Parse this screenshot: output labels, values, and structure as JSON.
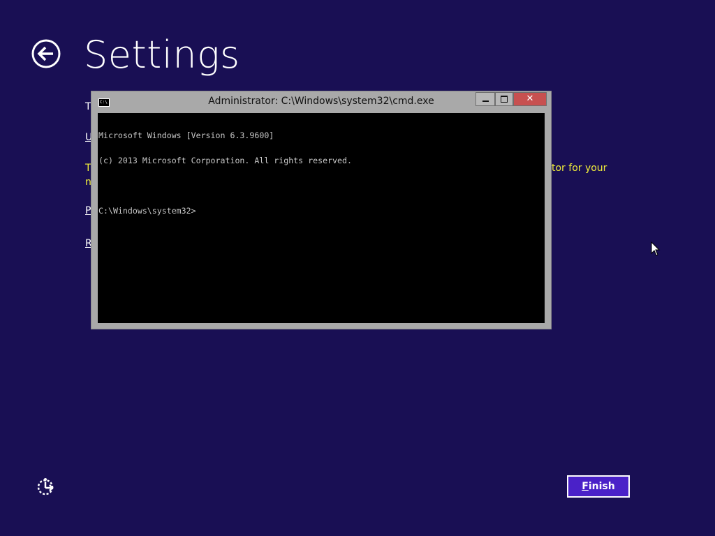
{
  "page": {
    "title": "Settings",
    "background_color": "#190f54",
    "accent_color": "#4a21c8"
  },
  "background_text": {
    "line1": "T",
    "line2": "U",
    "line3a": "T",
    "line3b": "n",
    "line3_right": "tor for your",
    "line4": "P",
    "line5": "R"
  },
  "cmd_window": {
    "title": "Administrator: C:\\Windows\\system32\\cmd.exe",
    "app_icon_label": "C:\\",
    "console_lines": [
      "Microsoft Windows [Version 6.3.9600]",
      "(c) 2013 Microsoft Corporation. All rights reserved.",
      "",
      "C:\\Windows\\system32>"
    ],
    "buttons": {
      "minimize": "minimize-icon",
      "maximize": "maximize-icon",
      "close": "close-icon"
    }
  },
  "footer": {
    "finish_accel": "F",
    "finish_rest": "inish",
    "accessibility_icon": "ease-of-access-icon"
  },
  "icons": {
    "back": "back-arrow-icon",
    "cursor": "mouse-pointer-icon"
  }
}
